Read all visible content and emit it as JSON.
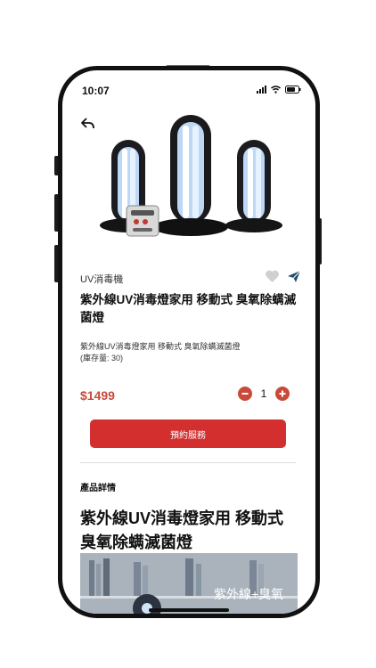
{
  "status_bar": {
    "time": "10:07"
  },
  "product": {
    "category": "UV消毒機",
    "title": "紫外線UV消毒燈家用 移動式 臭氧除螨滅菌燈",
    "description": "紫外線UV消毒燈家用 移動式 臭氧除螨滅菌燈",
    "stock": "(庫存量: 30)",
    "price": "$1499",
    "quantity": "1"
  },
  "actions": {
    "book_label": "預約服務"
  },
  "details": {
    "heading": "產品詳情",
    "title": "紫外線UV消毒燈家用 移動式 臭氧除螨滅菌燈",
    "image_overlay": "紫外線+臭氧"
  },
  "colors": {
    "accent": "#d32f2f",
    "price": "#c94a3a",
    "share": "#1f4e6b"
  }
}
